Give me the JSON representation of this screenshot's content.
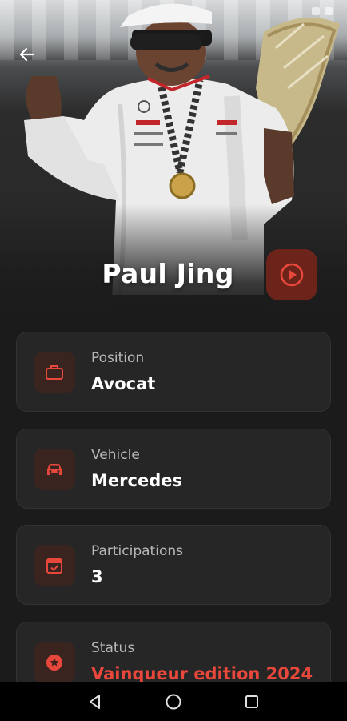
{
  "profile": {
    "name": "Paul Jing"
  },
  "icons": {
    "back": "arrow-left-icon",
    "play": "play-circle-icon",
    "position": "briefcase-icon",
    "vehicle": "car-icon",
    "participations": "calendar-check-icon",
    "status": "star-badge-icon"
  },
  "colors": {
    "accent": "#e8473b",
    "background": "#1b1b1b",
    "card": "#262626",
    "icon_box": "#3a2420"
  },
  "details": [
    {
      "label": "Position",
      "value": "Avocat"
    },
    {
      "label": "Vehicle",
      "value": "Mercedes"
    },
    {
      "label": "Participations",
      "value": "3"
    },
    {
      "label": "Status",
      "value": "Vainqueur edition 2024"
    }
  ],
  "navbar": {
    "back": "nav-back-icon",
    "home": "nav-home-icon",
    "recents": "nav-recents-icon"
  }
}
